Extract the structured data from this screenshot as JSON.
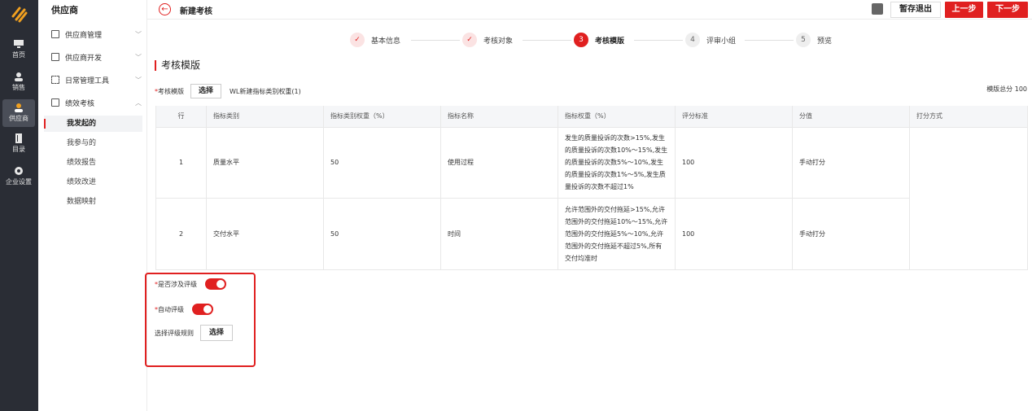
{
  "rail": {
    "items": [
      {
        "label": "首页",
        "icon": "monitor-icon"
      },
      {
        "label": "销售",
        "icon": "user-icon"
      },
      {
        "label": "供应商",
        "icon": "supplier-user-icon"
      },
      {
        "label": "目录",
        "icon": "book-icon"
      },
      {
        "label": "企业设置",
        "icon": "gear-icon"
      }
    ],
    "active": "供应商"
  },
  "sidebar": {
    "title": "供应商",
    "groups": [
      {
        "label": "供应商管理",
        "icon": "list-icon",
        "expanded": false
      },
      {
        "label": "供应商开发",
        "icon": "clipboard-icon",
        "expanded": false
      },
      {
        "label": "日常管理工具",
        "icon": "grid-icon",
        "expanded": false
      },
      {
        "label": "绩效考核",
        "icon": "card-icon",
        "expanded": true
      }
    ],
    "subitems": [
      "我发起的",
      "我参与的",
      "绩效报告",
      "绩效改进",
      "数据映射"
    ],
    "active_subitem": "我发起的"
  },
  "header": {
    "title": "新建考核",
    "save_exit": "暂存退出",
    "prev": "上一步",
    "next": "下一步"
  },
  "steps": [
    {
      "num": "",
      "label": "基本信息",
      "state": "done"
    },
    {
      "num": "",
      "label": "考核对象",
      "state": "done"
    },
    {
      "num": "3",
      "label": "考核模版",
      "state": "current"
    },
    {
      "num": "4",
      "label": "评审小组",
      "state": "todo"
    },
    {
      "num": "5",
      "label": "预览",
      "state": "todo"
    }
  ],
  "section": {
    "title": "考核模版",
    "template_label": "考核模版",
    "select_label": "选择",
    "template_name": "WL新建指标类别权重(1)",
    "total": "模版总分 100"
  },
  "table": {
    "headers": [
      "行",
      "指标类别",
      "指标类别权重（%）",
      "指标名称",
      "指标权重（%）",
      "评分标准",
      "分值",
      "打分方式"
    ],
    "rows": [
      {
        "row": "1",
        "category": "质量水平",
        "category_weight": "50",
        "name": "使用过程",
        "weight": "发生的质量投诉的次数>15%,发生的质量投诉的次数10%～15%,发生的质量投诉的次数5%～10%,发生的质量投诉的次数1%～5%,发生质量投诉的次数不超过1%",
        "standard": "100",
        "score": "手动打分",
        "method": ""
      },
      {
        "row": "2",
        "category": "交付水平",
        "category_weight": "50",
        "name": "时间",
        "weight": "允许范围外的交付拖延>15%,允许范围外的交付拖延10%～15%,允许范围外的交付拖延5%～10%,允许范围外的交付拖延不超过5%,所有交付均准时",
        "standard": "100",
        "score": "手动打分",
        "method": ""
      }
    ]
  },
  "grading": {
    "involves_label": "是否涉及评级",
    "involves_on": true,
    "auto_label": "自动评级",
    "auto_on": true,
    "rule_label": "选择评级规则",
    "rule_button": "选择"
  },
  "colors": {
    "accent": "#e02020",
    "rail_bg": "#2a2d35",
    "header_bg": "#f5f6f8"
  }
}
